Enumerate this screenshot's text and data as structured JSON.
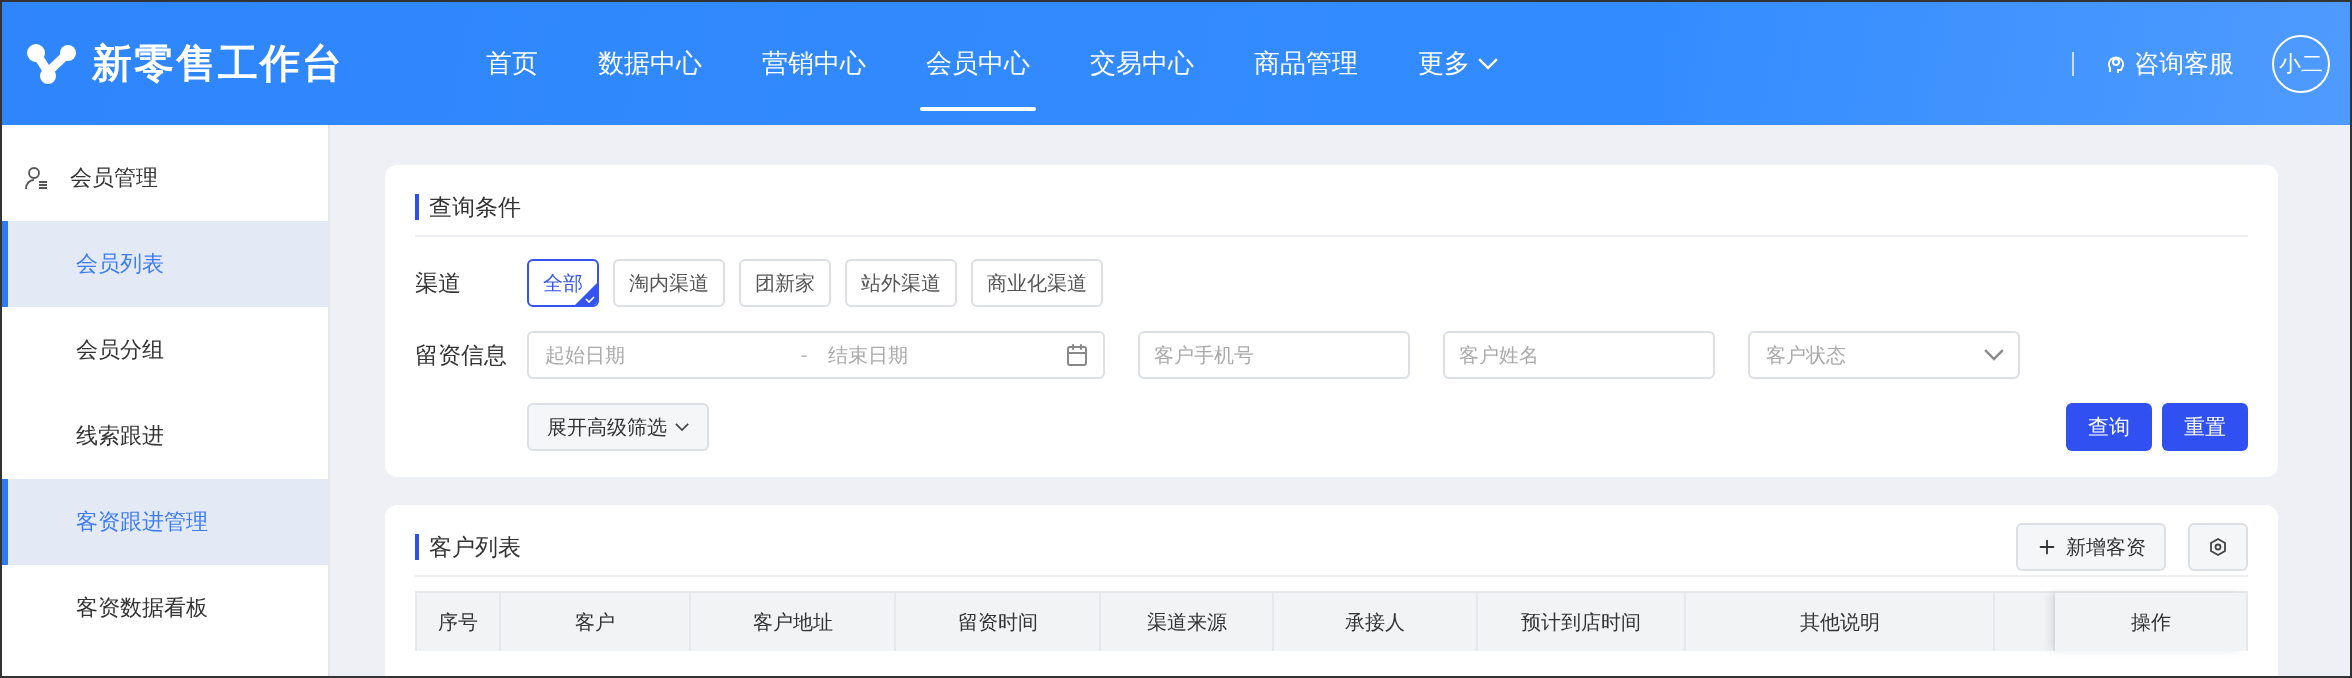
{
  "app": {
    "title": "新零售工作台"
  },
  "nav": [
    {
      "label": "首页",
      "selected": false,
      "kind": "link"
    },
    {
      "label": "数据中心",
      "selected": false,
      "kind": "link"
    },
    {
      "label": "营销中心",
      "selected": false,
      "kind": "link"
    },
    {
      "label": "会员中心",
      "selected": true,
      "kind": "link"
    },
    {
      "label": "交易中心",
      "selected": false,
      "kind": "link"
    },
    {
      "label": "商品管理",
      "selected": false,
      "kind": "link"
    },
    {
      "label": "更多",
      "selected": false,
      "kind": "dropdown"
    }
  ],
  "support": {
    "label": "咨询客服"
  },
  "avatar": {
    "label": "小二"
  },
  "sidebar": {
    "group": "会员管理",
    "items": [
      {
        "label": "会员列表",
        "selected": true
      },
      {
        "label": "会员分组",
        "selected": false
      },
      {
        "label": "线索跟进",
        "selected": false
      },
      {
        "label": "客资跟进管理",
        "selected": true
      },
      {
        "label": "客资数据看板",
        "selected": false
      }
    ]
  },
  "query": {
    "title": "查询条件",
    "channel_label": "渠道",
    "channels": [
      {
        "label": "全部",
        "selected": true
      },
      {
        "label": "淘内渠道",
        "selected": false
      },
      {
        "label": "团新家",
        "selected": false
      },
      {
        "label": "站外渠道",
        "selected": false
      },
      {
        "label": "商业化渠道",
        "selected": false
      }
    ],
    "info_label": "留资信息",
    "date_start": {
      "placeholder": "起始日期"
    },
    "date_separator": "-",
    "date_end": {
      "placeholder": "结束日期"
    },
    "phone": {
      "placeholder": "客户手机号"
    },
    "name": {
      "placeholder": "客户姓名"
    },
    "status": {
      "placeholder": "客户状态"
    },
    "expand_button": "展开高级筛选",
    "buttons": [
      "查询",
      "重置"
    ]
  },
  "customers": {
    "title": "客户列表",
    "add_button": "新增客资",
    "columns": [
      "序号",
      "客户",
      "客户地址",
      "留资时间",
      "渠道来源",
      "承接人",
      "预计到店时间",
      "其他说明"
    ],
    "operation_column": "操作"
  }
}
